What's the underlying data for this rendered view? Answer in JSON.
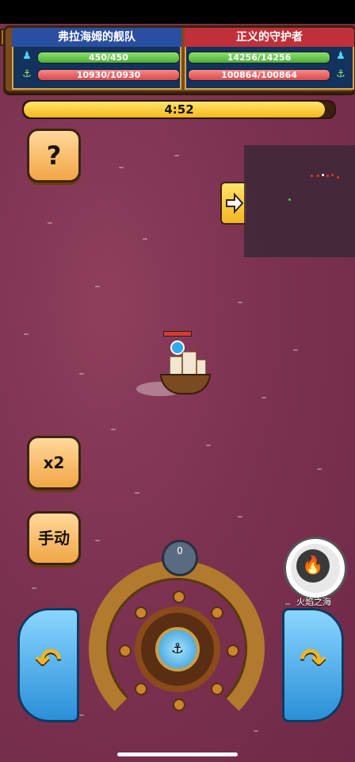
{
  "header": {
    "left_team": {
      "name": "弗拉海姆的舰队",
      "hp": "450/450",
      "shield": "10930/10930"
    },
    "right_team": {
      "name": "正义的守护者",
      "hp": "14256/14256",
      "shield": "100864/100864"
    }
  },
  "timer": {
    "text": "4:52",
    "progress": 0.97
  },
  "buttons": {
    "help": "?",
    "speed": "x2",
    "manual": "手动"
  },
  "skill": {
    "label": "火焰之海",
    "icon": "flame-icon"
  },
  "steering": {
    "dial_value": "0",
    "left_icon": "turn-left-arrow",
    "right_icon": "turn-right-arrow"
  },
  "colors": {
    "sea": "#7c3250",
    "left_team": "#2a4fa0",
    "right_team": "#c0303a",
    "hp_green": "#4cae38",
    "shield_red": "#d94a4a",
    "button_orange": "#f2a646",
    "turn_blue": "#2a8fd8"
  }
}
